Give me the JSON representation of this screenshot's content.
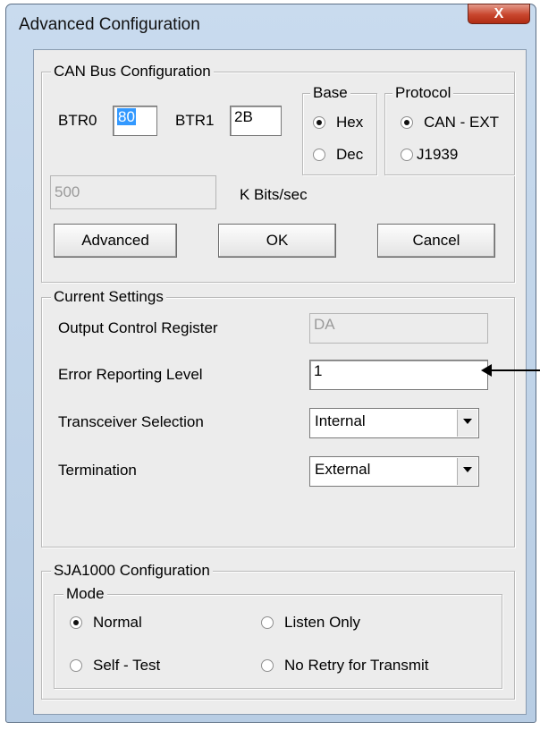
{
  "window": {
    "title": "Advanced Configuration",
    "close_label": "X"
  },
  "can_bus": {
    "legend": "CAN Bus Configuration",
    "btr0_label": "BTR0",
    "btr0_value": "80",
    "btr1_label": "BTR1",
    "btr1_value": "2B",
    "base": {
      "legend": "Base",
      "options": [
        "Hex",
        "Dec"
      ],
      "selected": "Hex"
    },
    "protocol": {
      "legend": "Protocol",
      "options": [
        "CAN - EXT",
        "J1939"
      ],
      "selected": "CAN - EXT"
    },
    "bitrate_value": "500",
    "bitrate_unit": "K Bits/sec",
    "buttons": {
      "advanced": "Advanced",
      "ok": "OK",
      "cancel": "Cancel"
    }
  },
  "current_settings": {
    "legend": "Current Settings",
    "output_control_label": "Output Control Register",
    "output_control_value": "DA",
    "error_reporting_label": "Error Reporting Level",
    "error_reporting_value": "1",
    "transceiver_label": "Transceiver Selection",
    "transceiver_value": "Internal",
    "termination_label": "Termination",
    "termination_value": "External"
  },
  "sja1000": {
    "legend": "SJA1000 Configuration",
    "mode_legend": "Mode",
    "modes": [
      "Normal",
      "Listen Only",
      "Self - Test",
      "No Retry for Transmit"
    ],
    "selected": "Normal"
  },
  "annotation": {
    "arrow_icon": "left-arrow-icon"
  }
}
